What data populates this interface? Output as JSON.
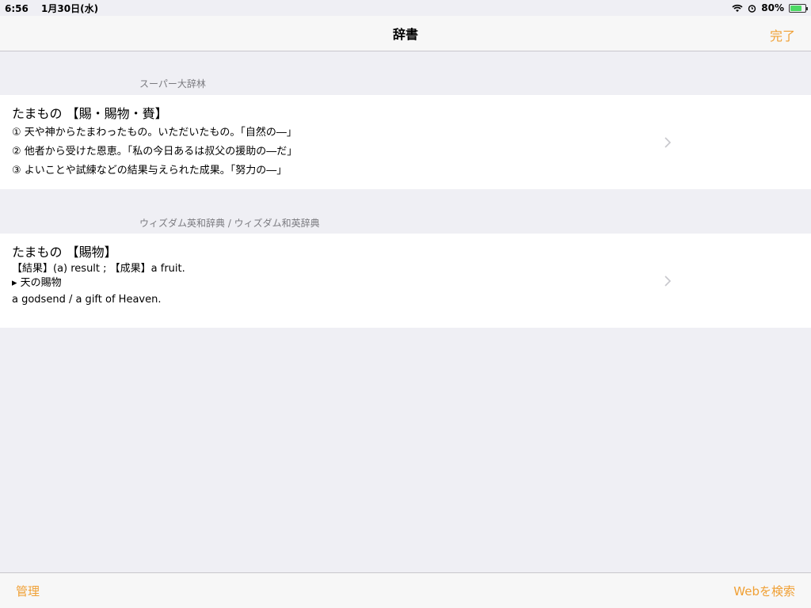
{
  "status": {
    "time": "6:56",
    "date": "1月30日(水)",
    "battery_pct": "80%",
    "battery_level": 0.8
  },
  "nav": {
    "title": "辞書",
    "done_label": "完了"
  },
  "sections": [
    {
      "header": "スーパー大辞林",
      "headword": "たまもの 【賜・賜物・賚】",
      "lines": [
        "① 天や神からたまわったもの。いただいたもの。「自然の―」",
        "② 他者から受けた恩恵。「私の今日あるは叔父の援助の―だ」",
        "③ よいことや試練などの結果与えられた成果。「努力の―」"
      ]
    },
    {
      "header": "ウィズダム英和辞典 / ウィズダム和英辞典",
      "headword": "たまもの 【賜物】",
      "lines": [
        "【結果】(a) result ; 【成果】a fruit.",
        "▸ 天の賜物",
        "a godsend / a gift of Heaven."
      ]
    }
  ],
  "toolbar": {
    "manage_label": "管理",
    "web_search_label": "Webを検索"
  },
  "colors": {
    "accent": "#f0a035",
    "background": "#efeff4"
  }
}
